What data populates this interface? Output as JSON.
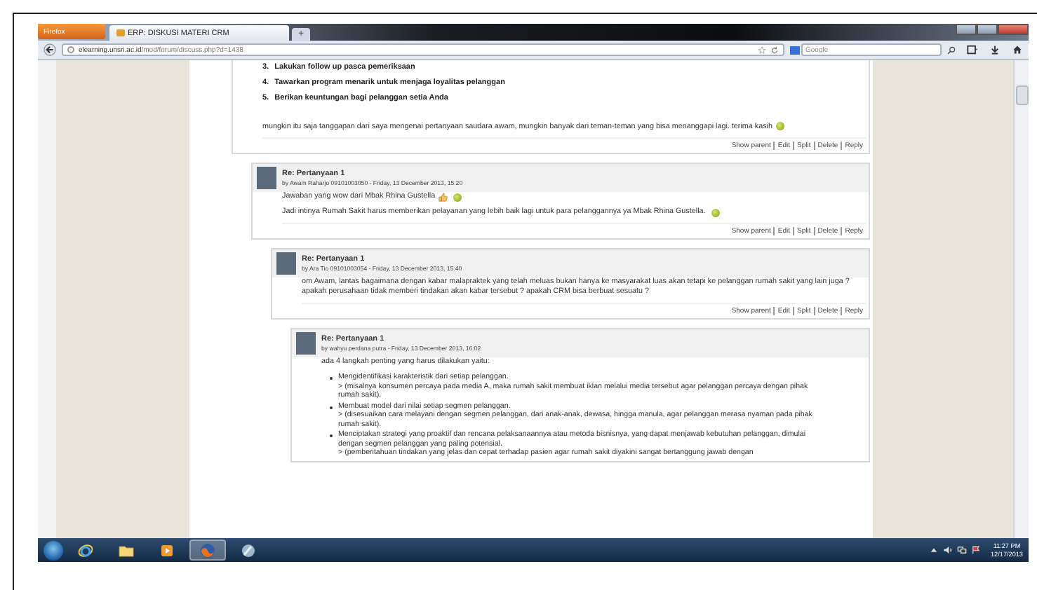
{
  "browser": {
    "menu_button": "Firefox",
    "tab_title": "ERP: DISKUSI MATERI CRM",
    "new_tab": "+",
    "url_host": "elearning.unsri.ac.id",
    "url_path": "/mod/forum/discuss.php?d=1438",
    "search_placeholder": "Google"
  },
  "posts": [
    {
      "blocks": [
        {
          "kind": "numbered",
          "items": [
            {
              "number": "3.",
              "text": "Lakukan follow up pasca pemeriksaan"
            },
            {
              "number": "4.",
              "text": "Tawarkan program menarik untuk menjaga loyalitas pelanggan"
            },
            {
              "number": "5.",
              "text": "Berikan keuntungan bagi pelanggan setia Anda"
            }
          ]
        },
        {
          "kind": "paragraph",
          "text": "mungkin itu saja tanggapan dari saya mengenai pertanyaan saudara awam, mungkin banyak dari teman-teman yang bisa menanggapi lagi.  terima kasih",
          "smiley": true
        }
      ],
      "actions": [
        "Show parent",
        "Edit",
        "Split",
        "Delete",
        "Reply"
      ]
    },
    {
      "header": {
        "subject": "Re: Pertanyaan 1",
        "byline": "by Awam Raharjo 09101003050 - Friday, 13 December 2013, 15:20"
      },
      "blocks": [
        {
          "kind": "paragraph",
          "text": "Jawaban yang wow dari Mbak Rhina Gustella",
          "thumbs_up": true,
          "smiley": true
        },
        {
          "kind": "paragraph",
          "text": "Jadi intinya Rumah Sakit harus memberikan pelayanan yang lebih baik lagi untuk para pelanggannya ya Mbak Rhina Gustella.",
          "smiley": true
        }
      ],
      "actions": [
        "Show parent",
        "Edit",
        "Split",
        "Delete",
        "Reply"
      ]
    },
    {
      "header": {
        "subject": "Re: Pertanyaan 1",
        "byline": "by Ara Tio 09101003054 - Friday, 13 December 2013, 15:40"
      },
      "blocks": [
        {
          "kind": "paragraph",
          "text": "om Awam, lantas bagaimana dengan kabar malapraktek yang telah meluas bukan hanya ke masyarakat luas akan tetapi ke pelanggan rumah sakit yang lain juga ? apakah perusahaan tidak memberi tindakan akan kabar tersebut ? apakah CRM bisa berbuat sesuatu ?"
        }
      ],
      "actions": [
        "Show parent",
        "Edit",
        "Split",
        "Delete",
        "Reply"
      ]
    },
    {
      "header": {
        "subject": "Re: Pertanyaan 1",
        "byline": "by wahyu perdana putra - Friday, 13 December 2013, 16:02"
      },
      "blocks": [
        {
          "kind": "paragraph",
          "text": "ada 4 langkah penting yang harus dilakukan yaitu:"
        },
        {
          "kind": "bullets",
          "items": [
            {
              "text": "Mengidentifikasi karakteristik dari setiap pelanggan.",
              "note": "> (misalnya konsumen percaya pada media A, maka rumah sakit membuat iklan melalui media tersebut agar pelanggan percaya dengan pihak rumah sakit)."
            },
            {
              "text": "Membuat model dari nilai setiap segmen pelanggan.",
              "note": "> (disesuaikan cara melayani dengan segmen pelanggan, dari anak-anak, dewasa, hingga manula, agar pelanggan merasa nyaman pada pihak rumah sakit)."
            },
            {
              "text": "Menciptakan strategi yang proaktif dan rencana pelaksanaannya atau metoda bisnisnya, yang dapat menjawab kebutuhan pelanggan, dimulai dengan segmen pelanggan yang paling potensial.",
              "note": "> (pemberitahuan tindakan yang jelas dan cepat terhadap pasien agar rumah sakit diyakini sangat bertanggung jawab dengan"
            }
          ]
        }
      ]
    }
  ],
  "taskbar": {
    "apps": [
      {
        "kind": "ie",
        "selected": false
      },
      {
        "kind": "folder",
        "selected": false
      },
      {
        "kind": "media",
        "selected": false
      },
      {
        "kind": "firefox",
        "selected": true
      },
      {
        "kind": "tool",
        "selected": false
      }
    ],
    "time": "11:27 PM",
    "date": "12/17/2013"
  }
}
